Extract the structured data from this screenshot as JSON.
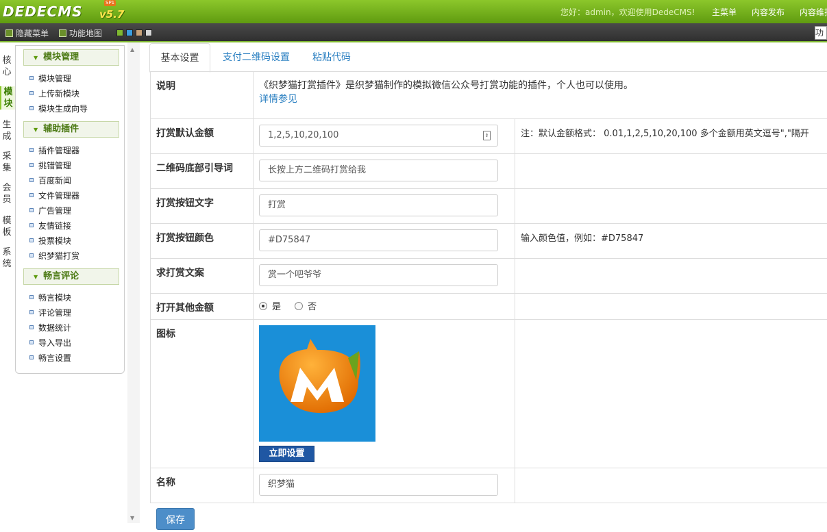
{
  "header": {
    "logo": "DEDECMS",
    "version": "v5.7",
    "badge": "SP1",
    "welcome": "您好：admin，欢迎使用DedeCMS!",
    "nav": [
      "主菜单",
      "内容发布",
      "内容维护"
    ]
  },
  "toolbar": {
    "hide_menu": "隐藏菜单",
    "site_map": "功能地图",
    "swatches": [
      "#7fb830",
      "#3a9ee0",
      "#c8a27a",
      "#d8d8d8"
    ],
    "func_button": "功"
  },
  "vtabs": [
    {
      "label": "核心",
      "active": false
    },
    {
      "label": "模块",
      "active": true
    },
    {
      "label": "生成",
      "active": false
    },
    {
      "label": "采集",
      "active": false
    },
    {
      "label": "会员",
      "active": false
    },
    {
      "label": "模板",
      "active": false
    },
    {
      "label": "系统",
      "active": false
    }
  ],
  "sidebar": {
    "sections": [
      {
        "title": "模块管理",
        "items": [
          "模块管理",
          "上传新模块",
          "模块生成向导"
        ]
      },
      {
        "title": "辅助插件",
        "items": [
          "插件管理器",
          "挑错管理",
          "百度新闻",
          "文件管理器",
          "广告管理",
          "友情链接",
          "投票模块",
          "织梦猫打赏"
        ]
      },
      {
        "title": "畅言评论",
        "items": [
          "畅言模块",
          "评论管理",
          "数据统计",
          "导入导出",
          "畅言设置"
        ]
      }
    ]
  },
  "tabs": [
    "基本设置",
    "支付二维码设置",
    "粘贴代码"
  ],
  "form": {
    "desc_label": "说明",
    "desc_text": "《织梦猫打赏插件》是织梦猫制作的模拟微信公众号打赏功能的插件，个人也可以使用。",
    "desc_link": "详情参见",
    "amount_label": "打赏默认金额",
    "amount_value": "1,2,5,10,20,100",
    "amount_note": "注：默认金额格式： 0.01,1,2,5,10,20,100 多个金额用英文逗号\",\"隔开",
    "qr_label": "二维码底部引导词",
    "qr_value": "长按上方二维码打赏给我",
    "btn_text_label": "打赏按钮文字",
    "btn_text_value": "打赏",
    "btn_color_label": "打赏按钮颜色",
    "btn_color_value": "#D75847",
    "btn_color_note": "输入颜色值，例如：#D75847",
    "ask_label": "求打赏文案",
    "ask_value": "赏一个吧爷爷",
    "other_label": "打开其他金额",
    "other_yes": "是",
    "other_no": "否",
    "other_selected": "是",
    "icon_label": "图标",
    "icon_button": "立即设置",
    "name_label": "名称",
    "name_value": "织梦猫"
  },
  "save_button": "保存"
}
